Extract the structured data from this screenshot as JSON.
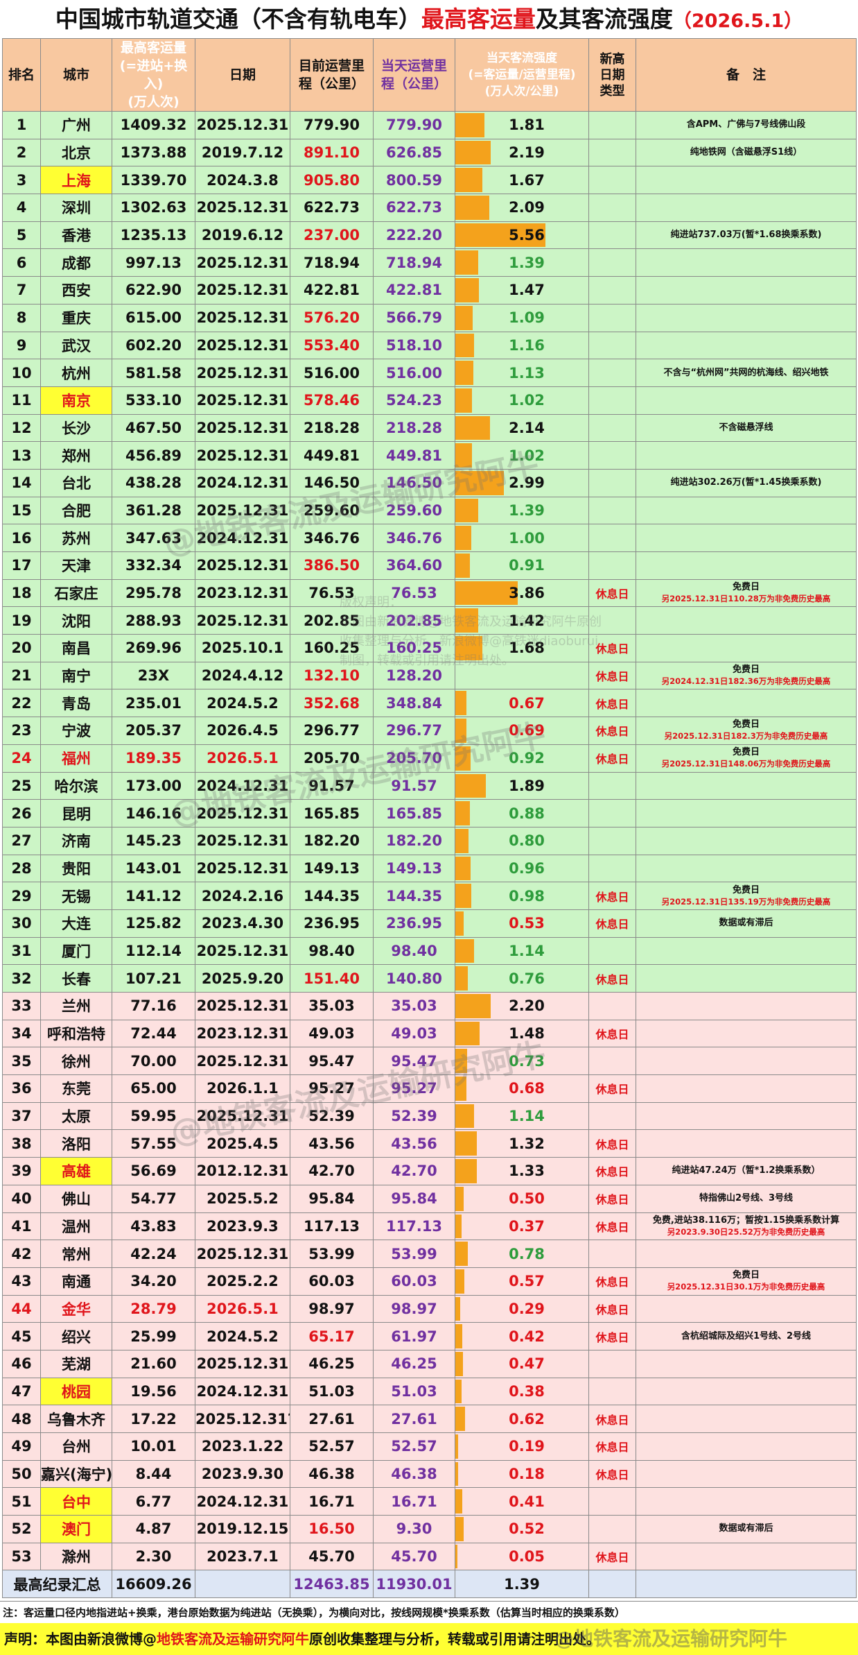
{
  "title": {
    "part1": "中国城市轨道交通（不含有轨电车）",
    "part2": "最高客运量",
    "part3": "及其客流强度",
    "part4": "（2026.5.1）"
  },
  "header": {
    "rank": "排名",
    "city": "城市",
    "peak": "最高客运量\n(=进站+换入)\n(万人次)",
    "date": "日期",
    "length": "目前运营里\n程（公里）",
    "length_day": "当天运营里\n程（公里）",
    "intensity": "当天客流强度\n(=客运量/运营里程)\n(万人次/公里)",
    "type": "新高\n日期\n类型",
    "note": "备　注"
  },
  "rows": [
    {
      "rank": "1",
      "city": "广州",
      "peak": "1409.32",
      "date": "2025.12.31",
      "length": "779.90",
      "length_day": "779.90",
      "intensity": "1.81",
      "type": "",
      "note": "含APM、广佛与7号线佛山段",
      "zone": "g"
    },
    {
      "rank": "2",
      "city": "北京",
      "peak": "1373.88",
      "date": "2019.7.12",
      "length": "891.10",
      "length_red": true,
      "length_day": "626.85",
      "intensity": "2.19",
      "type": "",
      "note": "纯地铁网（含磁悬浮S1线）",
      "zone": "g"
    },
    {
      "rank": "3",
      "city": "上海",
      "city_hl": true,
      "peak": "1339.70",
      "date": "2024.3.8",
      "length": "905.80",
      "length_red": true,
      "length_day": "800.59",
      "intensity": "1.67",
      "type": "",
      "note": "",
      "zone": "g"
    },
    {
      "rank": "4",
      "city": "深圳",
      "peak": "1302.63",
      "date": "2025.12.31",
      "length": "622.73",
      "length_day": "622.73",
      "intensity": "2.09",
      "type": "",
      "note": "",
      "zone": "g"
    },
    {
      "rank": "5",
      "city": "香港",
      "peak": "1235.13",
      "date": "2019.6.12",
      "length": "237.00",
      "length_red": true,
      "length_day": "222.20",
      "intensity": "5.56",
      "type": "",
      "note": "纯进站737.03万(暂*1.68换乘系数)",
      "zone": "g"
    },
    {
      "rank": "6",
      "city": "成都",
      "peak": "997.13",
      "date": "2025.12.31",
      "length": "718.94",
      "length_day": "718.94",
      "intensity": "1.39",
      "type": "",
      "note": "",
      "zone": "g"
    },
    {
      "rank": "7",
      "city": "西安",
      "peak": "622.90",
      "date": "2025.12.31",
      "length": "422.81",
      "length_day": "422.81",
      "intensity": "1.47",
      "type": "",
      "note": "",
      "zone": "g"
    },
    {
      "rank": "8",
      "city": "重庆",
      "peak": "615.00",
      "date": "2025.12.31",
      "length": "576.20",
      "length_red": true,
      "length_day": "566.79",
      "intensity": "1.09",
      "type": "",
      "note": "",
      "zone": "g"
    },
    {
      "rank": "9",
      "city": "武汉",
      "peak": "602.20",
      "date": "2025.12.31",
      "length": "553.40",
      "length_red": true,
      "length_day": "518.10",
      "intensity": "1.16",
      "type": "",
      "note": "",
      "zone": "g"
    },
    {
      "rank": "10",
      "city": "杭州",
      "peak": "581.58",
      "date": "2025.12.31",
      "length": "516.00",
      "length_day": "516.00",
      "intensity": "1.13",
      "type": "",
      "note": "不含与“杭州网”共网的杭海线、绍兴地铁",
      "zone": "g"
    },
    {
      "rank": "11",
      "city": "南京",
      "city_hl": true,
      "peak": "533.10",
      "date": "2025.12.31",
      "length": "578.46",
      "length_red": true,
      "length_day": "524.23",
      "intensity": "1.02",
      "type": "",
      "note": "",
      "zone": "g"
    },
    {
      "rank": "12",
      "city": "长沙",
      "peak": "467.50",
      "date": "2025.12.31",
      "length": "218.28",
      "length_day": "218.28",
      "intensity": "2.14",
      "type": "",
      "note": "不含磁悬浮线",
      "zone": "g"
    },
    {
      "rank": "13",
      "city": "郑州",
      "peak": "456.89",
      "date": "2025.12.31",
      "length": "449.81",
      "length_day": "449.81",
      "intensity": "1.02",
      "type": "",
      "note": "",
      "zone": "g"
    },
    {
      "rank": "14",
      "city": "台北",
      "peak": "438.28",
      "date": "2024.12.31",
      "length": "146.50",
      "length_day": "146.50",
      "intensity": "2.99",
      "type": "",
      "note": "纯进站302.26万(暂*1.45换乘系数)",
      "zone": "g"
    },
    {
      "rank": "15",
      "city": "合肥",
      "peak": "361.28",
      "date": "2025.12.31",
      "length": "259.60",
      "length_day": "259.60",
      "intensity": "1.39",
      "type": "",
      "note": "",
      "zone": "g"
    },
    {
      "rank": "16",
      "city": "苏州",
      "peak": "347.63",
      "date": "2024.12.31",
      "length": "346.76",
      "length_day": "346.76",
      "intensity": "1.00",
      "type": "",
      "note": "",
      "zone": "g"
    },
    {
      "rank": "17",
      "city": "天津",
      "peak": "332.34",
      "date": "2025.12.31",
      "length": "386.50",
      "length_red": true,
      "length_day": "364.60",
      "intensity": "0.91",
      "type": "",
      "note": "",
      "zone": "g"
    },
    {
      "rank": "18",
      "city": "石家庄",
      "peak": "295.78",
      "date": "2023.12.31",
      "length": "76.53",
      "length_day": "76.53",
      "intensity": "3.86",
      "type": "休息日",
      "note": "免费日",
      "note2": "另2025.12.31日110.28万为非免费历史最高",
      "zone": "g"
    },
    {
      "rank": "19",
      "city": "沈阳",
      "peak": "288.93",
      "date": "2025.12.31",
      "length": "202.85",
      "length_day": "202.85",
      "intensity": "1.42",
      "type": "",
      "note": "",
      "zone": "g"
    },
    {
      "rank": "20",
      "city": "南昌",
      "peak": "269.96",
      "date": "2025.10.1",
      "length": "160.25",
      "length_day": "160.25",
      "intensity": "1.68",
      "type": "休息日",
      "note": "",
      "zone": "g"
    },
    {
      "rank": "21",
      "city": "南宁",
      "peak": "23X",
      "date": "2024.4.12",
      "length": "132.10",
      "length_red": true,
      "length_day": "128.20",
      "intensity": "",
      "type": "休息日",
      "note": "免费日",
      "note2": "另2024.12.31日182.36万为非免费历史最高",
      "zone": "g"
    },
    {
      "rank": "22",
      "city": "青岛",
      "peak": "235.01",
      "date": "2024.5.2",
      "length": "352.68",
      "length_red": true,
      "length_day": "348.84",
      "intensity": "0.67",
      "int_red": true,
      "type": "休息日",
      "note": "",
      "zone": "g"
    },
    {
      "rank": "23",
      "city": "宁波",
      "peak": "205.37",
      "date": "2026.4.5",
      "length": "296.77",
      "length_day": "296.77",
      "intensity": "0.69",
      "int_red": true,
      "type": "休息日",
      "note": "免费日",
      "note2": "另2025.12.31日182.3万为非免费历史最高",
      "zone": "g"
    },
    {
      "rank": "24",
      "city": "福州",
      "city_red": true,
      "rank_red": true,
      "peak": "189.35",
      "peak_red": true,
      "date": "2026.5.1",
      "date_red": true,
      "length": "205.70",
      "length_day": "205.70",
      "intensity": "0.92",
      "type": "休息日",
      "note": "免费日",
      "note2": "另2025.12.31日148.06万为非免费历史最高",
      "zone": "g"
    },
    {
      "rank": "25",
      "city": "哈尔滨",
      "peak": "173.00",
      "date": "2024.12.31",
      "length": "91.57",
      "length_day": "91.57",
      "intensity": "1.89",
      "type": "",
      "note": "",
      "zone": "g"
    },
    {
      "rank": "26",
      "city": "昆明",
      "peak": "146.16",
      "date": "2025.12.31",
      "length": "165.85",
      "length_day": "165.85",
      "intensity": "0.88",
      "type": "",
      "note": "",
      "zone": "g"
    },
    {
      "rank": "27",
      "city": "济南",
      "peak": "145.23",
      "date": "2025.12.31",
      "length": "182.20",
      "length_day": "182.20",
      "intensity": "0.80",
      "type": "",
      "note": "",
      "zone": "g"
    },
    {
      "rank": "28",
      "city": "贵阳",
      "peak": "143.01",
      "date": "2025.12.31",
      "length": "149.13",
      "length_day": "149.13",
      "intensity": "0.96",
      "type": "",
      "note": "",
      "zone": "g"
    },
    {
      "rank": "29",
      "city": "无锡",
      "peak": "141.12",
      "date": "2024.2.16",
      "length": "144.35",
      "length_day": "144.35",
      "intensity": "0.98",
      "type": "休息日",
      "note": "免费日",
      "note2": "另2025.12.31日135.19万为非免费历史最高",
      "zone": "g"
    },
    {
      "rank": "30",
      "city": "大连",
      "peak": "125.82",
      "date": "2023.4.30",
      "length": "236.95",
      "length_day": "236.95",
      "intensity": "0.53",
      "int_red": true,
      "type": "休息日",
      "note": "数据或有滞后",
      "zone": "g"
    },
    {
      "rank": "31",
      "city": "厦门",
      "peak": "112.14",
      "date": "2025.12.31",
      "length": "98.40",
      "length_day": "98.40",
      "intensity": "1.14",
      "type": "",
      "note": "",
      "zone": "g"
    },
    {
      "rank": "32",
      "city": "长春",
      "peak": "107.21",
      "date": "2025.9.20",
      "length": "151.40",
      "length_red": true,
      "length_day": "140.80",
      "intensity": "0.76",
      "type": "休息日",
      "note": "",
      "zone": "g"
    },
    {
      "rank": "33",
      "city": "兰州",
      "peak": "77.16",
      "date": "2025.12.31",
      "length": "35.03",
      "length_day": "35.03",
      "intensity": "2.20",
      "type": "",
      "note": "",
      "zone": "p"
    },
    {
      "rank": "34",
      "city": "呼和浩特",
      "peak": "72.44",
      "date": "2023.12.31",
      "length": "49.03",
      "length_day": "49.03",
      "intensity": "1.48",
      "type": "休息日",
      "note": "",
      "zone": "p"
    },
    {
      "rank": "35",
      "city": "徐州",
      "peak": "70.00",
      "date": "2025.12.31",
      "length": "95.47",
      "length_day": "95.47",
      "intensity": "0.73",
      "type": "",
      "note": "",
      "zone": "p"
    },
    {
      "rank": "36",
      "city": "东莞",
      "peak": "65.00",
      "date": "2026.1.1",
      "length": "95.27",
      "length_day": "95.27",
      "intensity": "0.68",
      "int_red": true,
      "type": "休息日",
      "note": "",
      "zone": "p"
    },
    {
      "rank": "37",
      "city": "太原",
      "peak": "59.95",
      "date": "2025.12.31",
      "length": "52.39",
      "length_day": "52.39",
      "intensity": "1.14",
      "type": "",
      "note": "",
      "zone": "p"
    },
    {
      "rank": "38",
      "city": "洛阳",
      "peak": "57.55",
      "date": "2025.4.5",
      "length": "43.56",
      "length_day": "43.56",
      "intensity": "1.32",
      "type": "休息日",
      "note": "",
      "zone": "p"
    },
    {
      "rank": "39",
      "city": "高雄",
      "city_hl": true,
      "peak": "56.69",
      "date": "2012.12.31",
      "length": "42.70",
      "length_day": "42.70",
      "intensity": "1.33",
      "type": "休息日",
      "note": "纯进站47.24万（暂*1.2换乘系数）",
      "zone": "p"
    },
    {
      "rank": "40",
      "city": "佛山",
      "peak": "54.77",
      "date": "2025.5.2",
      "length": "95.84",
      "length_day": "95.84",
      "intensity": "0.50",
      "int_red": true,
      "type": "休息日",
      "note": "特指佛山2号线、3号线",
      "zone": "p"
    },
    {
      "rank": "41",
      "city": "温州",
      "peak": "43.83",
      "date": "2023.9.3",
      "length": "117.13",
      "length_day": "117.13",
      "intensity": "0.37",
      "int_red": true,
      "type": "休息日",
      "note": "免费,进站38.116万；暂按1.15换乘系数计算",
      "note2": "另2023.9.30日25.52万为非免费历史最高",
      "zone": "p"
    },
    {
      "rank": "42",
      "city": "常州",
      "peak": "42.24",
      "date": "2025.12.31",
      "length": "53.99",
      "length_day": "53.99",
      "intensity": "0.78",
      "type": "",
      "note": "",
      "zone": "p"
    },
    {
      "rank": "43",
      "city": "南通",
      "peak": "34.20",
      "date": "2025.2.2",
      "length": "60.03",
      "length_day": "60.03",
      "intensity": "0.57",
      "int_red": true,
      "type": "休息日",
      "note": "免费日",
      "note2": "另2025.12.31日30.1万为非免费历史最高",
      "zone": "p"
    },
    {
      "rank": "44",
      "city": "金华",
      "city_red": true,
      "rank_red": true,
      "peak": "28.79",
      "peak_red": true,
      "date": "2026.5.1",
      "date_red": true,
      "length": "98.97",
      "length_day": "98.97",
      "intensity": "0.29",
      "int_red": true,
      "type": "休息日",
      "note": "",
      "zone": "p"
    },
    {
      "rank": "45",
      "city": "绍兴",
      "peak": "25.99",
      "date": "2024.5.2",
      "length": "65.17",
      "length_red": true,
      "length_day": "61.97",
      "intensity": "0.42",
      "int_red": true,
      "type": "休息日",
      "note": "含杭绍城际及绍兴1号线、2号线",
      "zone": "p"
    },
    {
      "rank": "46",
      "city": "芜湖",
      "peak": "21.60",
      "date": "2025.12.31",
      "length": "46.25",
      "length_day": "46.25",
      "intensity": "0.47",
      "int_red": true,
      "type": "",
      "note": "",
      "zone": "p"
    },
    {
      "rank": "47",
      "city": "桃园",
      "city_hl": true,
      "peak": "19.56",
      "date": "2024.12.31",
      "length": "51.03",
      "length_day": "51.03",
      "intensity": "0.38",
      "int_red": true,
      "type": "",
      "note": "",
      "zone": "p"
    },
    {
      "rank": "48",
      "city": "乌鲁木齐",
      "peak": "17.22",
      "date": "2025.12.31?",
      "length": "27.61",
      "length_day": "27.61",
      "intensity": "0.62",
      "int_red": true,
      "type": "休息日",
      "note": "",
      "zone": "p"
    },
    {
      "rank": "49",
      "city": "台州",
      "peak": "10.01",
      "date": "2023.1.22",
      "length": "52.57",
      "length_day": "52.57",
      "intensity": "0.19",
      "int_red": true,
      "type": "休息日",
      "note": "",
      "zone": "p"
    },
    {
      "rank": "50",
      "city": "嘉兴(海宁)",
      "peak": "8.44",
      "date": "2023.9.30",
      "length": "46.38",
      "length_day": "46.38",
      "intensity": "0.18",
      "int_red": true,
      "type": "休息日",
      "note": "",
      "zone": "p"
    },
    {
      "rank": "51",
      "city": "台中",
      "city_hl": true,
      "peak": "6.77",
      "date": "2024.12.31",
      "length": "16.71",
      "length_day": "16.71",
      "intensity": "0.41",
      "int_red": true,
      "type": "",
      "note": "",
      "zone": "p"
    },
    {
      "rank": "52",
      "city": "澳门",
      "city_hl": true,
      "peak": "4.87",
      "date": "2019.12.15",
      "length": "16.50",
      "length_red": true,
      "length_day": "9.30",
      "intensity": "0.52",
      "int_red": true,
      "type": "",
      "note": "数据或有滞后",
      "zone": "p"
    },
    {
      "rank": "53",
      "city": "滁州",
      "peak": "2.30",
      "date": "2023.7.1",
      "length": "45.70",
      "length_day": "45.70",
      "intensity": "0.05",
      "int_red": true,
      "type": "休息日",
      "note": "",
      "zone": "p"
    }
  ],
  "summary": {
    "label": "最高纪录汇总",
    "peak": "16609.26",
    "length": "12463.85",
    "length_day": "11930.01",
    "intensity": "1.39"
  },
  "footnote": "注：客运量口径内地指进站+换乘，港台原始数据为纯进站（无换乘），为横向对比，按线网规模*换乘系数（估算当时相应的换乘系数）",
  "statement": {
    "a": "声明：本图由新浪微博@",
    "b": "地铁客流及运输研究阿牛",
    "c": "原创收集整理与分析，转载或引用请注明出处。"
  },
  "watermarks": {
    "wm": "@地铁客流及运输研究阿牛",
    "notice": "版权声明：\n本图由新浪微博@地铁客流及运输研究阿牛原创\n收集整理与分析，新浪微博@高铁迷diaoburui\n制图，转载或引用请注明出处。",
    "corner": "@地铁客流及运输研究阿牛"
  },
  "colors": {
    "green_zone": "#ccf5c6",
    "pink_zone": "#fde1e0",
    "header": "#f8c8a0",
    "bar": "#f4a21c",
    "highlight": "#ffff33",
    "red": "#e0151b",
    "purple": "#7030a0"
  }
}
